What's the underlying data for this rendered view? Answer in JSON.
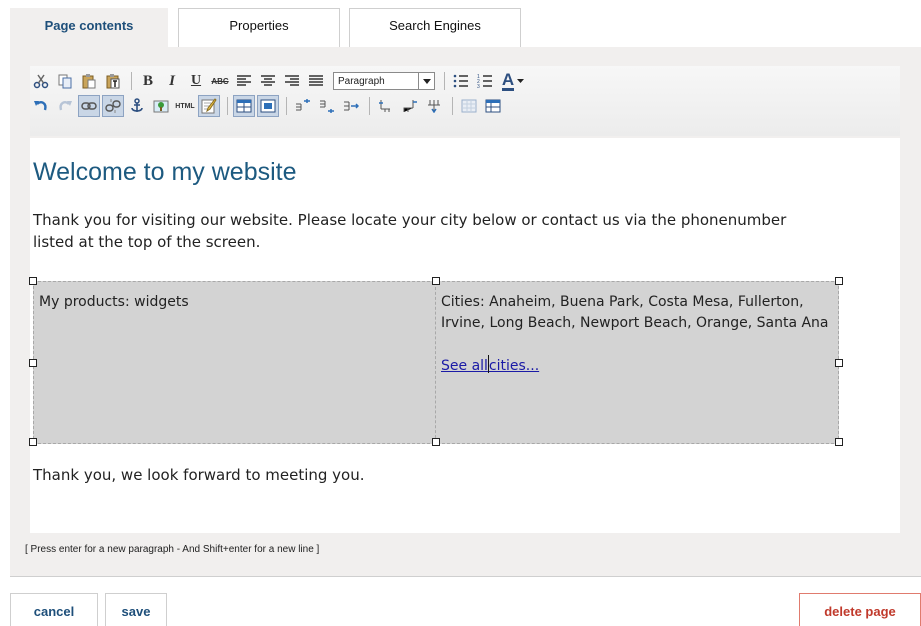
{
  "tabs": [
    {
      "label": "Page contents",
      "active": true
    },
    {
      "label": "Properties",
      "active": false
    },
    {
      "label": "Search Engines",
      "active": false
    }
  ],
  "toolbar": {
    "format_select": {
      "selected": "Paragraph"
    },
    "row1_icons": [
      "cut-icon",
      "copy-icon",
      "paste-icon",
      "paste-text-icon",
      "bold-icon",
      "italic-icon",
      "underline-icon",
      "strikethrough-icon",
      "align-left-icon",
      "align-center-icon",
      "align-right-icon",
      "align-justify-icon",
      "bulleted-list-icon",
      "numbered-list-icon",
      "text-color-icon"
    ],
    "row2_icons": [
      "undo-icon",
      "redo-icon",
      "link-icon",
      "unlink-icon",
      "anchor-icon",
      "image-icon",
      "html-source-icon",
      "edit-icon",
      "table-icon",
      "table-props-icon",
      "insert-row-before-icon",
      "insert-row-after-icon",
      "delete-row-icon",
      "insert-col-before-icon",
      "insert-col-after-icon",
      "delete-col-icon",
      "merge-cells-icon",
      "split-cells-icon"
    ],
    "bold_glyph": "B",
    "italic_glyph": "I",
    "underline_glyph": "U",
    "strike_glyph": "ABC",
    "textcolor_glyph": "A",
    "html_glyph": "HTML"
  },
  "content": {
    "heading": "Welcome to my website",
    "intro": "Thank you for visiting our website. Please locate your city below or contact us via the phonenumber listed at the top of the screen.",
    "table": {
      "cell1": "My products: widgets",
      "cell2_text": "Cities: Anaheim, Buena Park, Costa Mesa, Fullerton, Irvine, Long Beach, Newport Beach, Orange, Santa Ana",
      "link_before_caret": "See all",
      "link_after_caret": "cities..."
    },
    "closing": "Thank you, we look forward to meeting you."
  },
  "hint": "[ Press enter for a new paragraph - And Shift+enter for a new line ]",
  "buttons": {
    "cancel": "cancel",
    "save": "save",
    "delete": "delete page"
  },
  "colors": {
    "accent": "#1e4f7a",
    "heading": "#1d5a80",
    "danger": "#c0392b",
    "panel": "#f1efee"
  }
}
